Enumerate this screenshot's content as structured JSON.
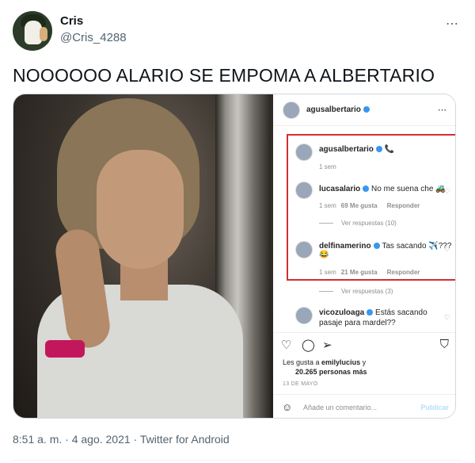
{
  "tweet": {
    "display_name": "Cris",
    "handle": "@Cris_4288",
    "more_icon": "⋯",
    "text": "NOOOOOO ALARIO SE EMPOMA A ALBERTARIO",
    "footer": "8:51 a. m. · 4 ago. 2021 · Twitter for Android"
  },
  "instagram": {
    "header_user": "agusalbertario",
    "more_icon": "⋯",
    "comments": [
      {
        "user": "agusalbertario",
        "text": "📞",
        "time": "1 sem",
        "likes": "",
        "reply": ""
      },
      {
        "user": "lucasalario",
        "text": "No me suena che 🚜",
        "time": "1 sem",
        "likes": "69 Me gusta",
        "reply": "Responder"
      },
      {
        "user": "delfinamerino",
        "text": "Tas sacando ✈️???😂",
        "time": "1 sem",
        "likes": "21 Me gusta",
        "reply": "Responder"
      },
      {
        "user": "vicozuloaga",
        "text": "Estás sacando pasaje para mardel??",
        "time": "",
        "likes": "",
        "reply": ""
      }
    ],
    "view_replies_1": "Ver respuestas (10)",
    "view_replies_2": "Ver respuestas (3)",
    "likes_line1_prefix": "Les gusta a ",
    "likes_line1_user": "emilylucius",
    "likes_line1_suffix": " y",
    "likes_line2": "20.265 personas más",
    "date": "13 DE MAYO",
    "comment_placeholder": "Añade un comentario...",
    "post_label": "Publicar"
  },
  "colors": {
    "highlight": "#d32f2f",
    "verified": "#3897f0",
    "muted": "#536471"
  }
}
